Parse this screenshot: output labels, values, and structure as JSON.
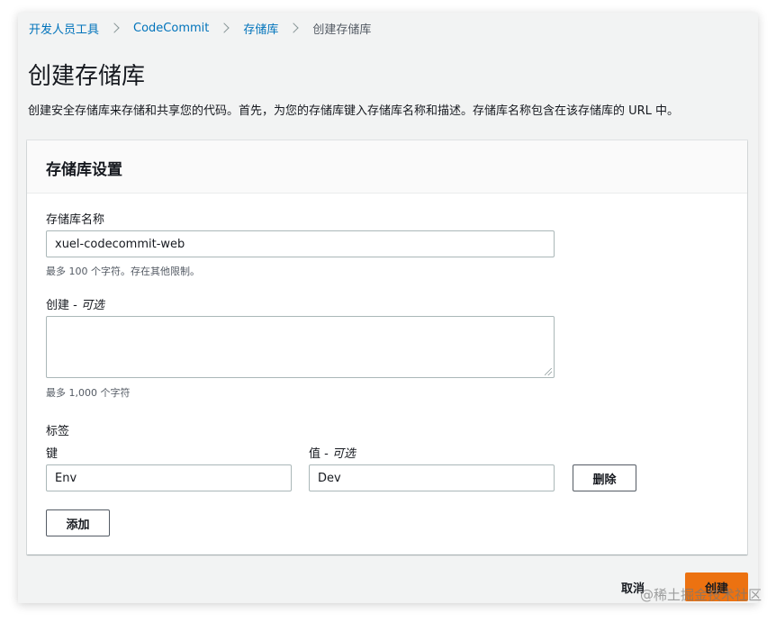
{
  "breadcrumb": {
    "items": [
      "开发人员工具",
      "CodeCommit",
      "存储库"
    ],
    "current": "创建存储库"
  },
  "page": {
    "title": "创建存储库",
    "description": "创建安全存储库来存储和共享您的代码。首先，为您的存储库键入存储库名称和描述。存储库名称包含在该存储库的 URL 中。"
  },
  "panel": {
    "title": "存储库设置",
    "name_label": "存储库名称",
    "name_value": "xuel-codecommit-web",
    "name_hint": "最多 100 个字符。存在其他限制。",
    "desc_label": "创建",
    "desc_optional": "可选",
    "desc_value": "",
    "desc_hint": "最多 1,000 个字符",
    "tags_label": "标签",
    "key_label": "键",
    "value_label": "值",
    "value_optional": "可选",
    "key_value": "Env",
    "value_value": "Dev",
    "remove_label": "删除",
    "add_label": "添加"
  },
  "footer": {
    "cancel_label": "取消",
    "create_label": "创建"
  },
  "watermark": "@稀土掘金技术社区",
  "colors": {
    "link": "#0073bb",
    "primary": "#ec7211",
    "background": "#f2f3f3"
  }
}
